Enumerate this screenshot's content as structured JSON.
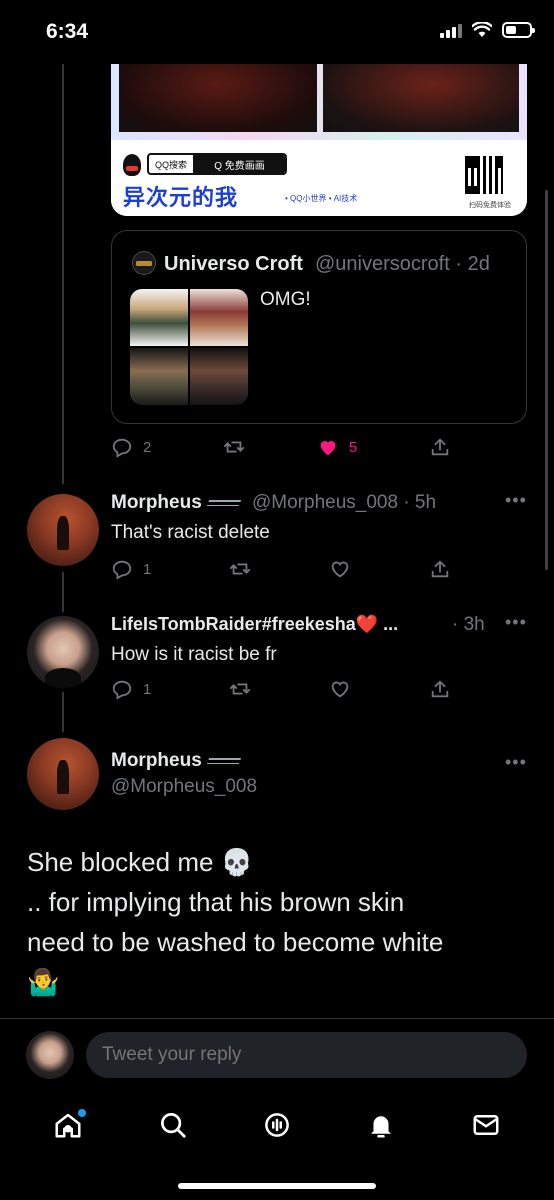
{
  "status_bar": {
    "time": "6:34"
  },
  "ad": {
    "search_left": "QQ搜索",
    "search_right": "Q 免费画画",
    "brand": "异次元的我",
    "sub": "• QQ小世界 • AI技术",
    "qr_caption": "扫码免费体验"
  },
  "quote": {
    "name": "Universo Croft",
    "handle": "@universocroft · 2d",
    "text": "OMG!"
  },
  "quote_actions": {
    "replies": "2",
    "likes": "5"
  },
  "replies": [
    {
      "name": "Morpheus",
      "handle": "@Morpheus_008 · 5h",
      "text": "That's racist delete",
      "reply_count": "1"
    },
    {
      "name": "LifeIsTombRaider#freekesha❤️ ...",
      "handle": "· 3h",
      "text": "How is it racist be fr",
      "reply_count": "1"
    }
  ],
  "main_tweet": {
    "name": "Morpheus",
    "handle": "@Morpheus_008",
    "line1": "She blocked me 💀",
    "line2": ".. for implying that his brown skin",
    "line3": "need to be washed to become white",
    "line4": "🤷‍♂️"
  },
  "composer": {
    "placeholder": "Tweet your reply"
  },
  "colors": {
    "accent": "#1d9bf0",
    "like": "#f91880",
    "muted": "#71767b"
  }
}
